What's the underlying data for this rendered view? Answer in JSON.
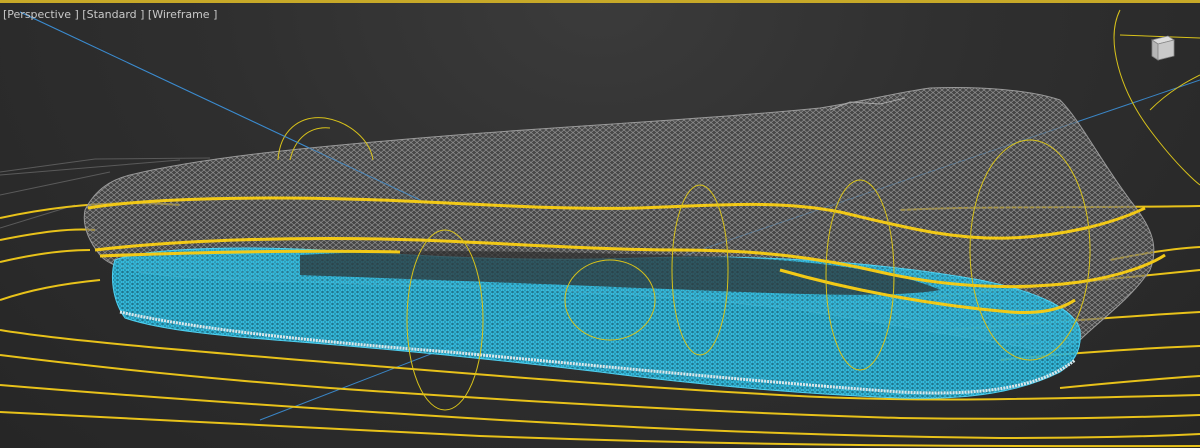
{
  "viewport": {
    "label_perspective": "[Perspective ]",
    "label_shading": "[Standard ]",
    "label_mode": "[Wireframe ]"
  },
  "colors": {
    "background": "#2b2b2b",
    "border_active": "#c7a928",
    "grid_line": "#6e6e6e",
    "spline_yellow": "#e8c21a",
    "mesh_gray": "#8a8a8a",
    "mesh_cyan": "#2fb4d4",
    "axis_blue": "#3c8fd6"
  },
  "icons": {
    "viewcube": "cube-icon"
  }
}
